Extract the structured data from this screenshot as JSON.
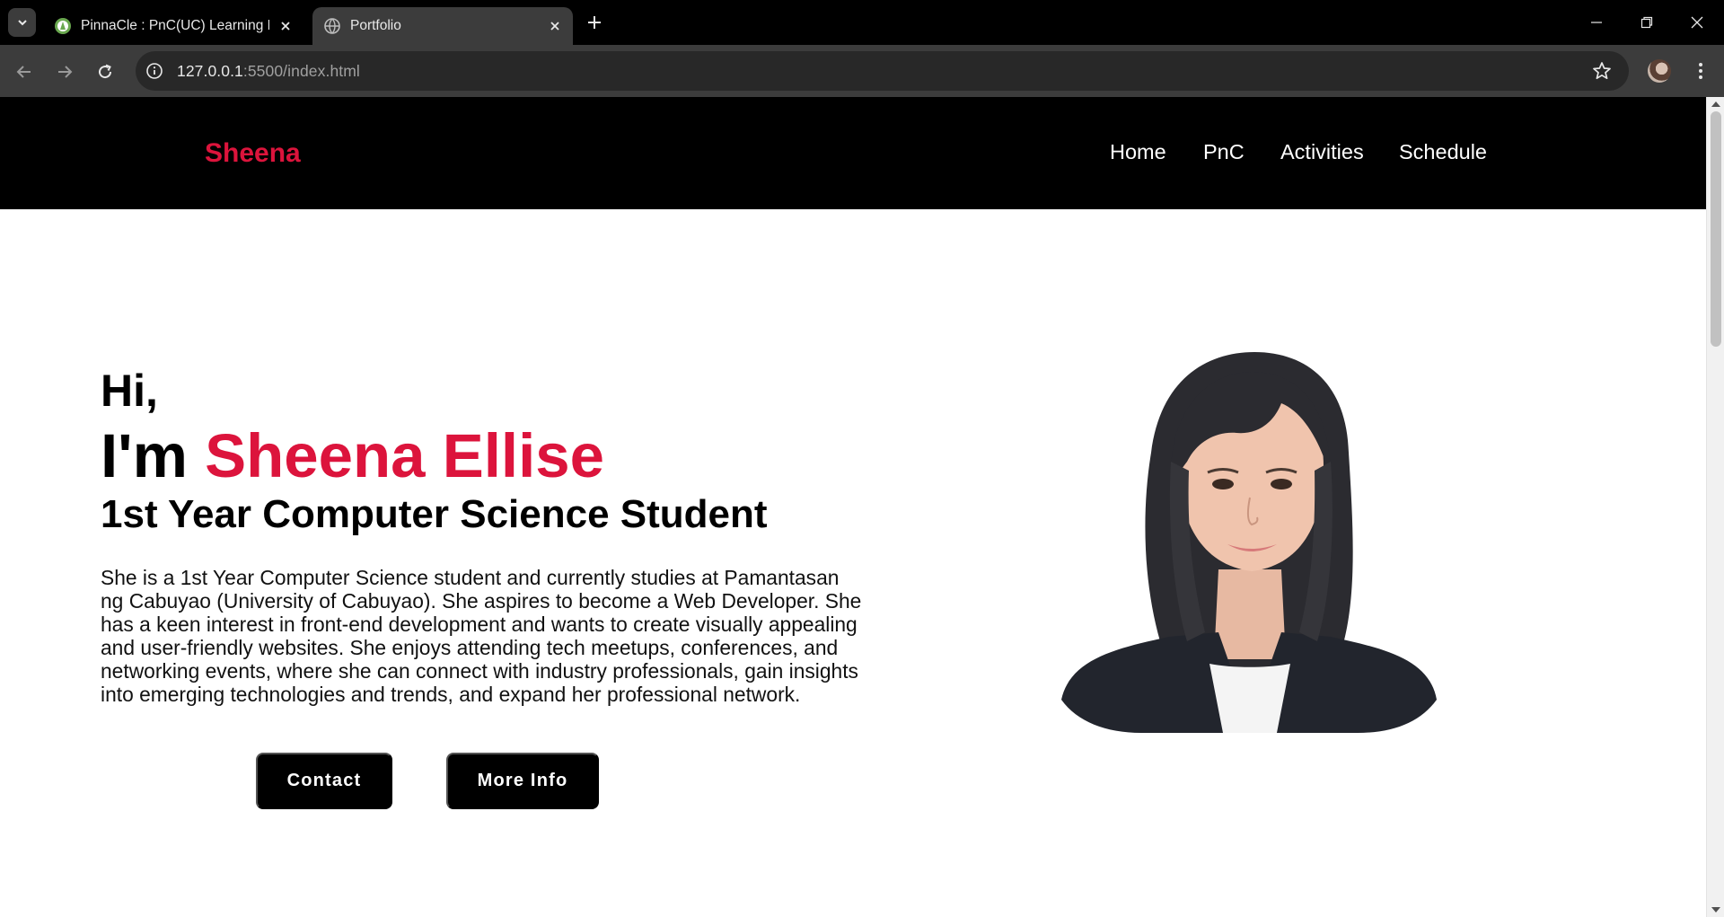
{
  "browser": {
    "tabs": [
      {
        "title": "PinnaCle : PnC(UC) Learning Ma",
        "active": false
      },
      {
        "title": "Portfolio",
        "active": true
      }
    ],
    "url_host": "127.0.0.1",
    "url_rest": ":5500/index.html"
  },
  "site": {
    "brand": "Sheena",
    "nav": [
      "Home",
      "PnC",
      "Activities",
      "Schedule"
    ]
  },
  "hero": {
    "greeting": "Hi,",
    "intro_prefix": "I'm ",
    "name": "Sheena Ellise",
    "role": "1st Year Computer Science Student",
    "description": "She is a 1st Year Computer Science student and currently studies at Pamantasan ng Cabuyao (University of Cabuyao). She aspires to become a Web Developer. She has a keen interest in front-end development and wants to create visually appealing and user-friendly websites. She enjoys attending tech meetups, conferences, and networking events, where she can connect with industry professionals, gain insights into emerging technologies and trends, and expand her professional network.",
    "buttons": {
      "contact": "Contact",
      "more_info": "More Info"
    }
  },
  "colors": {
    "accent": "#dc143c",
    "header_bg": "#000000",
    "button_bg": "#000000"
  }
}
